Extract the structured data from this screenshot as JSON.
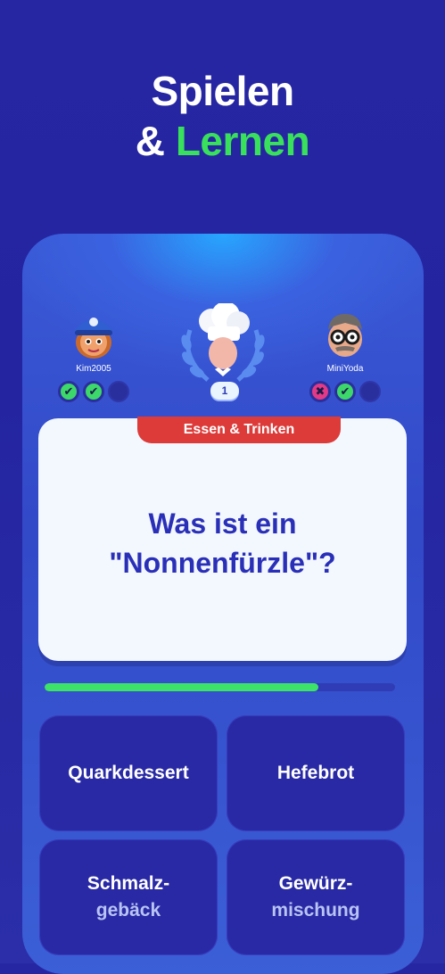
{
  "headline": {
    "line1": "Spielen",
    "amp": "&",
    "accent": "Lernen"
  },
  "players": {
    "left": {
      "name": "Kim2005",
      "results": [
        "correct",
        "correct",
        "pending"
      ]
    },
    "right": {
      "name": "MiniYoda",
      "results": [
        "wrong",
        "correct",
        "pending"
      ]
    }
  },
  "round": {
    "number": "1"
  },
  "question": {
    "category": "Essen & Trinken",
    "line1": "Was ist ein",
    "line2": "\"Nonnenfürzle\"?"
  },
  "progress": {
    "fraction": 0.78
  },
  "answers": [
    {
      "line1": "Quarkdessert",
      "line2": ""
    },
    {
      "line1": "Hefebrot",
      "line2": ""
    },
    {
      "line1": "Schmalz-",
      "line2": "gebäck"
    },
    {
      "line1": "Gewürz-",
      "line2": "mischung"
    }
  ],
  "colors": {
    "accent": "#39e05b",
    "correct": "#3cd86a",
    "wrong": "#e23a86",
    "category": "#dc3b39",
    "question_text": "#2a2fb8"
  },
  "icons": {
    "correct": "check-icon",
    "wrong": "cross-icon"
  }
}
